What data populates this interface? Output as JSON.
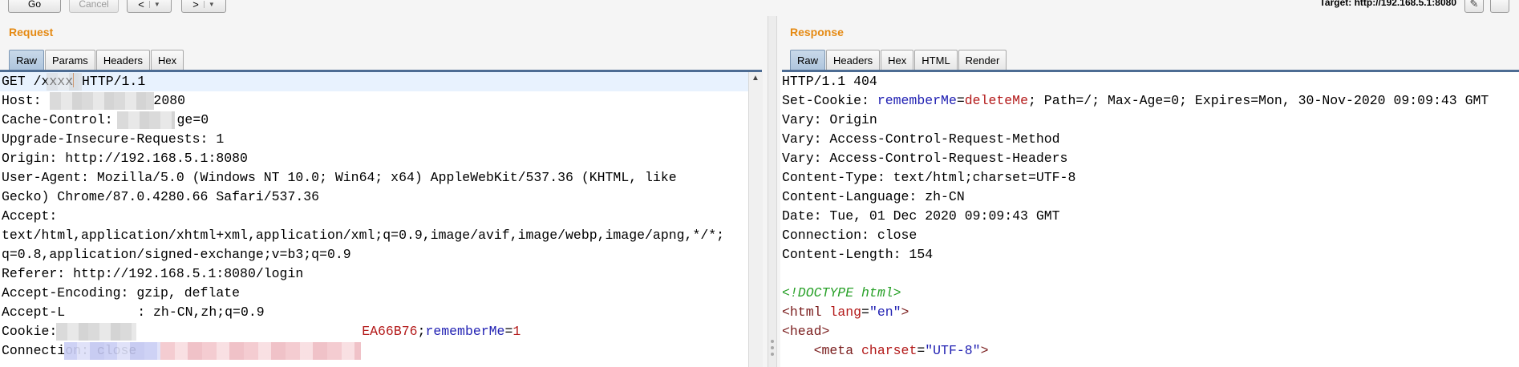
{
  "toolbar": {
    "go_label": "Go",
    "cancel_label": "Cancel",
    "back_arrow": "<",
    "forward_arrow": ">",
    "dropdown_glyph": "▼",
    "target": "Target: http://192.168.5.1:8080"
  },
  "request": {
    "title": "Request",
    "tabs": [
      "Raw",
      "Params",
      "Headers",
      "Hex"
    ],
    "lines": {
      "l1_a": "GET /xxxx",
      "l1_b": " HTTP/1.1",
      "l2_a": "Host: ",
      "l2_b": "2080",
      "l3_a": "Cache-Control: ",
      "l3_b": "ge=0",
      "l4": "Upgrade-Insecure-Requests: 1",
      "l5": "Origin: http://192.168.5.1:8080",
      "l6": "User-Agent: Mozilla/5.0 (Windows NT 10.0; Win64; x64) AppleWebKit/537.36 (KHTML, like",
      "l7": "Gecko) Chrome/87.0.4280.66 Safari/537.36",
      "l8": "Accept:",
      "l9": "text/html,application/xhtml+xml,application/xml;q=0.9,image/avif,image/webp,image/apng,*/*;",
      "l10": "q=0.8,application/signed-exchange;v=b3;q=0.9",
      "l11": "Referer: http://192.168.5.1:8080/login",
      "l12": "Accept-Encoding: gzip, deflate",
      "l13_a": "Accept-L",
      "l13_b": ": zh-CN,zh;q=0.9",
      "l14_a": "Cookie: ",
      "l14_b": "EA66B76",
      "l14_c": ";",
      "l14_d": "rememberMe",
      "l14_e": "=",
      "l14_f": "1",
      "l15": "Connection: close"
    }
  },
  "response": {
    "title": "Response",
    "tabs": [
      "Raw",
      "Headers",
      "Hex",
      "HTML",
      "Render"
    ],
    "lines": {
      "l1": "HTTP/1.1 404",
      "l2_a": "Set-Cookie: ",
      "l2_b": "rememberMe",
      "l2_c": "=",
      "l2_d": "deleteMe",
      "l2_e": "; Path=/; Max-Age=0; Expires=Mon, 30-Nov-2020 09:09:43 GMT",
      "l3": "Vary: Origin",
      "l4": "Vary: Access-Control-Request-Method",
      "l5": "Vary: Access-Control-Request-Headers",
      "l6": "Content-Type: text/html;charset=UTF-8",
      "l7": "Content-Language: zh-CN",
      "l8": "Date: Tue, 01 Dec 2020 09:09:43 GMT",
      "l9": "Connection: close",
      "l10": "Content-Length: 154",
      "l11": "",
      "l12": "<!DOCTYPE html>",
      "l13_a": "<html ",
      "l13_b": "lang",
      "l13_c": "=",
      "l13_d": "\"en\"",
      "l13_e": ">",
      "l14": "<head>",
      "l15_a": "    <meta ",
      "l15_b": "charset",
      "l15_c": "=",
      "l15_d": "\"UTF-8\"",
      "l15_e": ">"
    }
  },
  "colors": {
    "accent_title": "#e58a13",
    "active_tab": "#adc4dc",
    "param_name": "#2222b3",
    "param_value": "#b31919"
  }
}
